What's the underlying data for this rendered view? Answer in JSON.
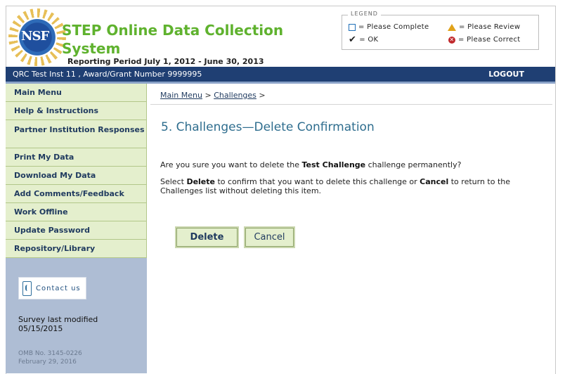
{
  "header": {
    "logo_text": "NSF",
    "app_title": "STEP Online Data Collection System",
    "reporting_period": "Reporting Period July 1, 2012 - June 30, 2013"
  },
  "legend": {
    "title": "LEGEND",
    "please_complete": "= Please Complete",
    "ok": "= OK",
    "please_review": "= Please Review",
    "please_correct": "= Please Correct"
  },
  "topbar": {
    "institution_info": "QRC Test Inst 11 , Award/Grant Number 9999995",
    "logout_label": "LOGOUT"
  },
  "sidebar": {
    "items": [
      {
        "label": "Main Menu"
      },
      {
        "label": "Help & Instructions"
      },
      {
        "label": "Partner Institution Responses"
      },
      {
        "label": "Print My Data"
      },
      {
        "label": "Download My Data"
      },
      {
        "label": "Add Comments/Feedback"
      },
      {
        "label": "Work Offline"
      },
      {
        "label": "Update Password"
      },
      {
        "label": "Repository/Library"
      }
    ],
    "contact_label": "Contact us",
    "survey_modified_line1": "Survey last modified",
    "survey_modified_line2": "05/15/2015",
    "omb_line1": "OMB No. 3145-0226",
    "omb_line2": "February 29, 2016"
  },
  "breadcrumb": {
    "main_menu": "Main Menu",
    "sep1": " > ",
    "challenges": "Challenges",
    "sep2": " >"
  },
  "main": {
    "title": "5. Challenges—Delete Confirmation",
    "question_pre": "Are you sure you want to delete the ",
    "question_item": "Test Challenge",
    "question_post": " challenge permanently?",
    "instr_1": "Select ",
    "instr_delete": "Delete",
    "instr_2": " to confirm that you want to delete this challenge or ",
    "instr_cancel": "Cancel",
    "instr_3": " to return to the Challenges list without deleting this item."
  },
  "buttons": {
    "delete_label": "Delete",
    "cancel_label": "Cancel"
  },
  "colors": {
    "title_green": "#5fb22e",
    "topbar_navy": "#1f3f73",
    "nav_bg": "#e4efcd",
    "sidebar_bg": "#aebdd4",
    "heading_teal": "#2e6d8e"
  }
}
